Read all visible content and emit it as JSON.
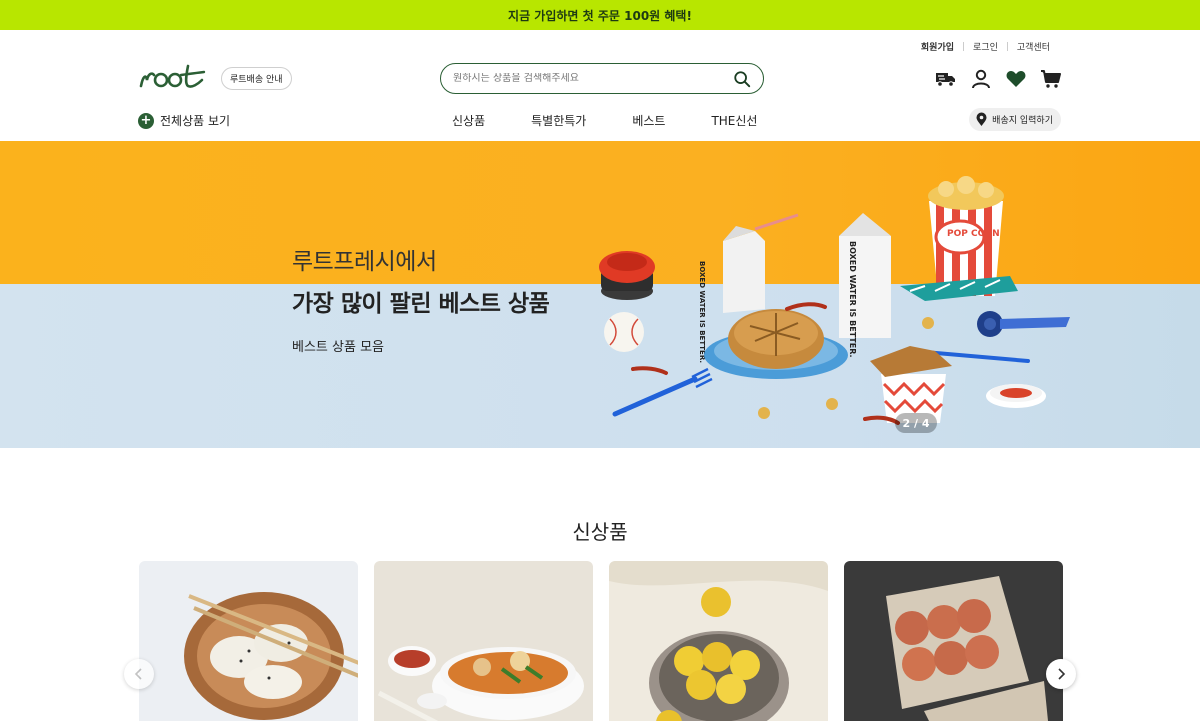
{
  "promo": {
    "text": "지금 가입하면 첫 주문 100원 혜택!"
  },
  "header": {
    "logo_text": "root",
    "delivery_guide": "루트배송 안내",
    "top_links": [
      "회원가입",
      "로그인",
      "고객센터"
    ],
    "search": {
      "placeholder": "원하시는 상품을 검색해주세요"
    },
    "util_icons": [
      "delivery-truck-icon",
      "user-icon",
      "heart-icon",
      "cart-icon"
    ],
    "all_products": "전체상품 보기",
    "nav": [
      "신상품",
      "특별한특가",
      "베스트",
      "THE신선"
    ],
    "address_button": "배송지 입력하기"
  },
  "banner": {
    "line1": "루트프레시에서",
    "line2": "가장 많이 팔린 베스트 상품",
    "line3": "베스트 상품 모음",
    "slide_indicator": "2 / 4",
    "art_labels": {
      "carton": "BOXED WATER IS BETTER.",
      "popcorn": "POP CORN"
    },
    "colors": {
      "top": "#fbb21c",
      "bottom": "#d3e3ef"
    }
  },
  "new_products": {
    "title": "신상품",
    "items": [
      "dumplings",
      "spicy-noodle-soup",
      "lemons",
      "eggs"
    ]
  },
  "colors": {
    "brand_green": "#2b5f35",
    "promo_bg": "#b8e600"
  }
}
